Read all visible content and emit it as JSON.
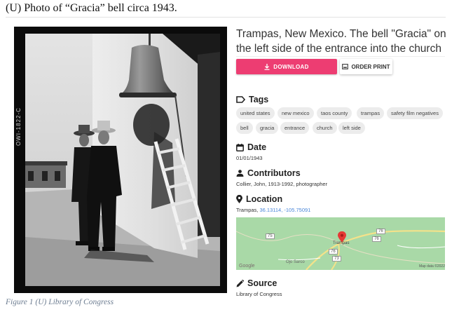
{
  "document": {
    "heading": "(U) Photo of “Gracia” bell circa 1943.",
    "caption": "Figure 1 (U) Library of Congress"
  },
  "photo": {
    "margin_text": "OWI-1822-C"
  },
  "record": {
    "title": "Trampas, New Mexico. The bell \"Gracia\" on the left side of the entrance into the church"
  },
  "actions": {
    "download_label": "DOWNLOAD",
    "order_print_label": "ORDER PRINT",
    "accent_color": "#ed3d72"
  },
  "tags": {
    "heading": "Tags",
    "items": [
      "united states",
      "new mexico",
      "taos county",
      "trampas",
      "safety film negatives",
      "bell",
      "gracia",
      "entrance",
      "church",
      "left side"
    ]
  },
  "date": {
    "heading": "Date",
    "value": "01/01/1943"
  },
  "contributors": {
    "heading": "Contributors",
    "value": "Collier, John, 1913-1992, photographer"
  },
  "location": {
    "heading": "Location",
    "place": "Trampas,",
    "coords": "36.13114, -105.75091"
  },
  "map": {
    "town": "Trampas",
    "place_2": "Ojo Sarco",
    "road_1": "75",
    "road_2": "76",
    "road_3": "76",
    "road_4": "73",
    "road_5": "76",
    "provider": "Google",
    "credit": "Map data ©2022"
  },
  "source": {
    "heading": "Source",
    "value": "Library of Congress"
  }
}
